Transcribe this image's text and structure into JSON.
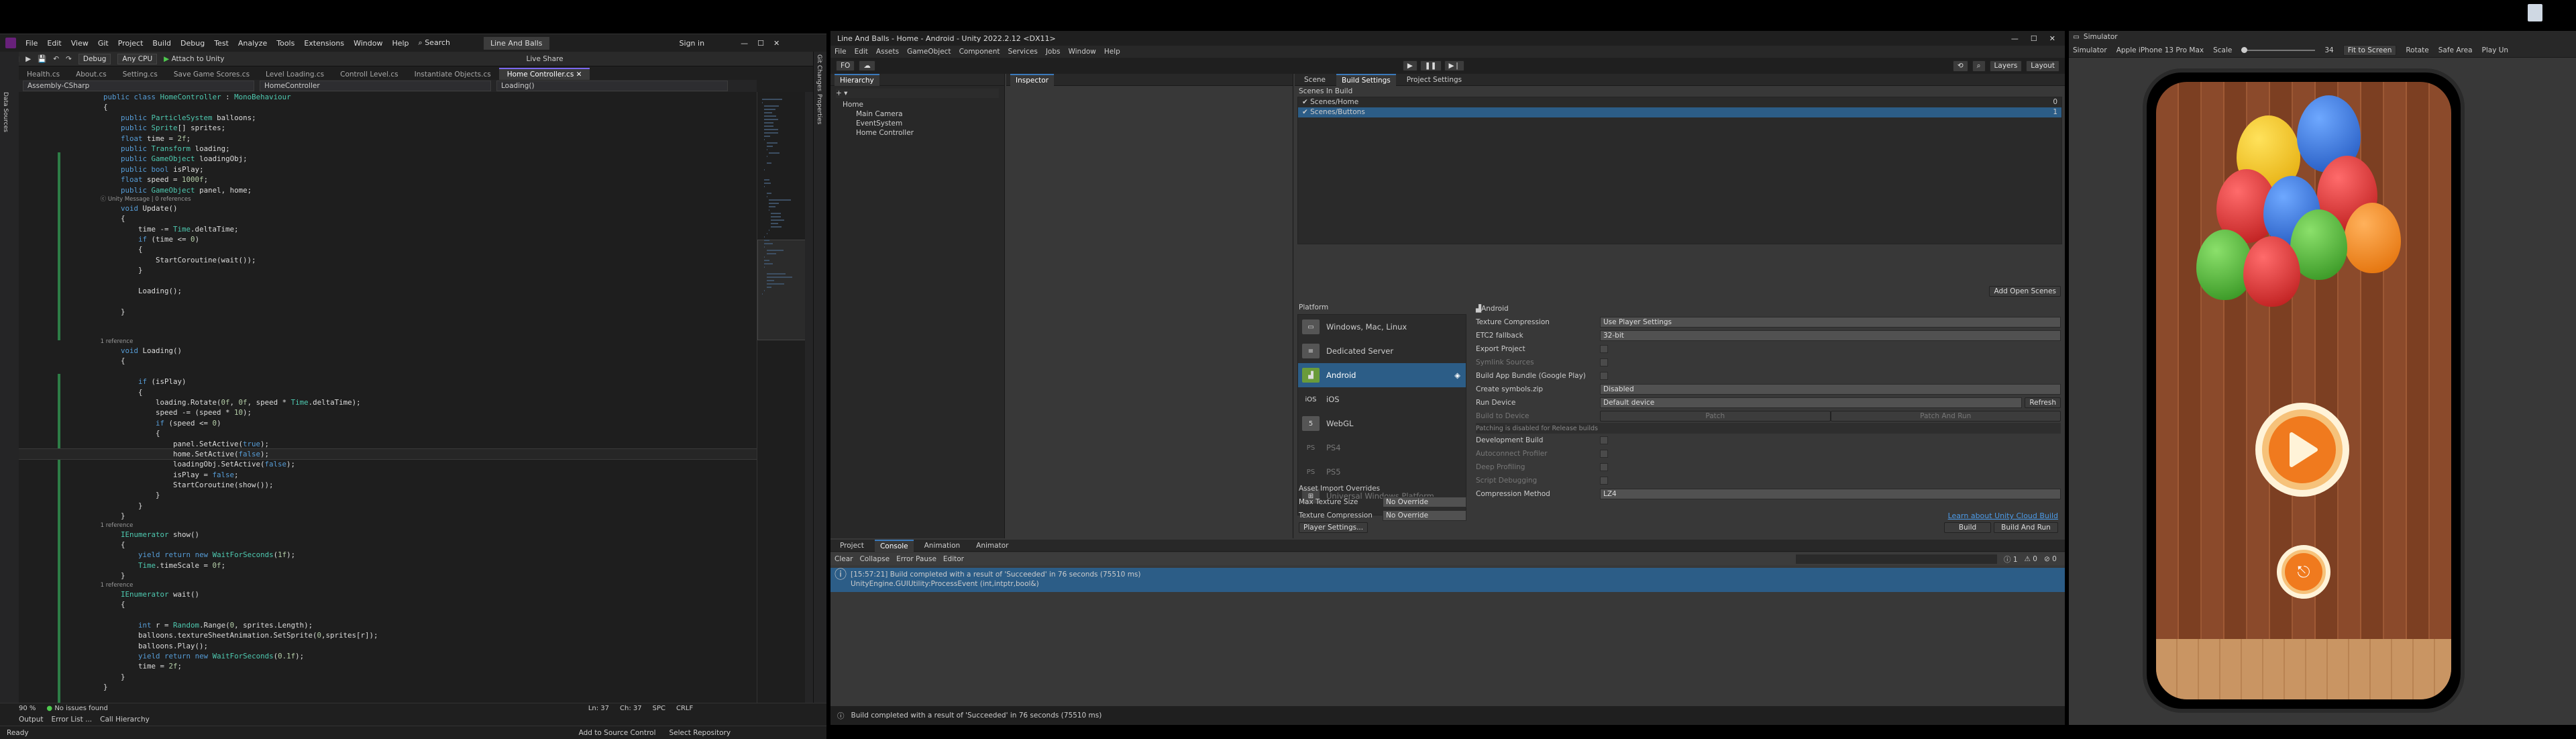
{
  "vs": {
    "menu": [
      "File",
      "Edit",
      "View",
      "Git",
      "Project",
      "Build",
      "Debug",
      "Test",
      "Analyze",
      "Tools",
      "Extensions",
      "Window",
      "Help"
    ],
    "search": "Search",
    "solution": "Line And Balls",
    "signin": "Sign in",
    "toolbar": {
      "config": "Debug",
      "platform": "Any CPU",
      "attach": "Attach to Unity",
      "liveshare": "Live Share"
    },
    "tabs": [
      "Health.cs",
      "About.cs",
      "Setting.cs",
      "Save Game Scores.cs",
      "Level Loading.cs",
      "Controll Level.cs",
      "Instantiate Objects.cs",
      "Home Controller.cs"
    ],
    "active_tab": "Home Controller.cs",
    "nav": {
      "project": "Assembly-CSharp",
      "class": "HomeController",
      "member": "Loading()"
    },
    "rail_right": [
      "Git Changes",
      "Properties"
    ],
    "rail_left": [
      "Data Sources"
    ],
    "code": [
      {
        "t": "    public class HomeController : MonoBehaviour"
      },
      {
        "t": "    {"
      },
      {
        "t": "        public ParticleSystem balloons;"
      },
      {
        "t": "        public Sprite[] sprites;"
      },
      {
        "t": "        float time = 2f;"
      },
      {
        "t": "        public Transform loading;"
      },
      {
        "t": "        public GameObject loadingObj;"
      },
      {
        "t": "        public bool isPlay;"
      },
      {
        "t": "        float speed = 1000f;"
      },
      {
        "t": "        public GameObject panel, home;"
      },
      {
        "t": "        ⓒ Unity Message | 0 references",
        "cl": true
      },
      {
        "t": "        void Update()"
      },
      {
        "t": "        {"
      },
      {
        "t": "            time -= Time.deltaTime;"
      },
      {
        "t": "            if (time <= 0)"
      },
      {
        "t": "            {"
      },
      {
        "t": "                StartCoroutine(wait());"
      },
      {
        "t": "            }"
      },
      {
        "t": ""
      },
      {
        "t": "            Loading();"
      },
      {
        "t": ""
      },
      {
        "t": "        }"
      },
      {
        "t": ""
      },
      {
        "t": ""
      },
      {
        "t": "        1 reference",
        "cl": true
      },
      {
        "t": "        void Loading()"
      },
      {
        "t": "        {"
      },
      {
        "t": ""
      },
      {
        "t": "            if (isPlay)"
      },
      {
        "t": "            {"
      },
      {
        "t": "                loading.Rotate(0f, 0f, speed * Time.deltaTime);"
      },
      {
        "t": "                speed -= (speed * 10);"
      },
      {
        "t": "                if (speed <= 0)"
      },
      {
        "t": "                {"
      },
      {
        "t": "                    panel.SetActive(true);"
      },
      {
        "t": "                    home.SetActive(false);",
        "hl": true
      },
      {
        "t": "                    loadingObj.SetActive(false);"
      },
      {
        "t": "                    isPlay = false;"
      },
      {
        "t": "                    StartCoroutine(show());"
      },
      {
        "t": "                }"
      },
      {
        "t": "            }"
      },
      {
        "t": "        }"
      },
      {
        "t": "        1 reference",
        "cl": true
      },
      {
        "t": "        IEnumerator show()"
      },
      {
        "t": "        {"
      },
      {
        "t": "            yield return new WaitForSeconds(1f);"
      },
      {
        "t": "            Time.timeScale = 0f;"
      },
      {
        "t": "        }"
      },
      {
        "t": "        1 reference",
        "cl": true
      },
      {
        "t": "        IEnumerator wait()"
      },
      {
        "t": "        {"
      },
      {
        "t": ""
      },
      {
        "t": "            int r = Random.Range(0, sprites.Length);"
      },
      {
        "t": "            balloons.textureSheetAnimation.SetSprite(0,sprites[r]);"
      },
      {
        "t": "            balloons.Play();"
      },
      {
        "t": "            yield return new WaitForSeconds(0.1f);"
      },
      {
        "t": "            time = 2f;"
      },
      {
        "t": "        }"
      },
      {
        "t": "    }"
      }
    ],
    "statusline": {
      "zoom": "90 %",
      "issues": "No issues found",
      "ln": "Ln: 37",
      "ch": "Ch: 37",
      "spc": "SPC",
      "crlf": "CRLF"
    },
    "bottom_tabs": [
      "Output",
      "Error List ...",
      "Call Hierarchy"
    ],
    "status": {
      "ready": "Ready",
      "source_control": "Add to Source Control",
      "repo": "Select Repository"
    }
  },
  "unity": {
    "title": "Line And Balls - Home - Android - Unity 2022.2.12 <DX11>",
    "menu": [
      "File",
      "Edit",
      "Assets",
      "GameObject",
      "Component",
      "Services",
      "Jobs",
      "Window",
      "Help"
    ],
    "toolbar": {
      "account": "FO",
      "layers": "Layers",
      "layout": "Layout"
    },
    "hierarchy_tab": "Hierarchy",
    "hierarchy": [
      "Home",
      "Main Camera",
      "EventSystem",
      "Home Controller"
    ],
    "inspector_tab": "Inspector",
    "build_tabs": [
      "Scene",
      "Build Settings",
      "Project Settings"
    ],
    "scenes_title": "Scenes In Build",
    "scenes": [
      {
        "name": "Scenes/Home",
        "idx": "0"
      },
      {
        "name": "Scenes/Buttons",
        "idx": "1"
      }
    ],
    "add_open_scenes": "Add Open Scenes",
    "platform_title": "Platform",
    "platforms": [
      {
        "name": "Windows, Mac, Linux",
        "icon": "monitor-icon"
      },
      {
        "name": "Dedicated Server",
        "icon": "server-icon"
      },
      {
        "name": "Android",
        "icon": "android-icon"
      },
      {
        "name": "iOS",
        "icon": "ios-icon"
      },
      {
        "name": "WebGL",
        "icon": "webgl-icon"
      },
      {
        "name": "PS4",
        "icon": "ps4-icon"
      },
      {
        "name": "PS5",
        "icon": "ps5-icon"
      },
      {
        "name": "Universal Windows Platform",
        "icon": "windows-icon"
      }
    ],
    "selected_platform": "Android",
    "android_title": "Android",
    "settings": [
      {
        "label": "Texture Compression",
        "value": "Use Player Settings"
      },
      {
        "label": "ETC2 fallback",
        "value": "32-bit"
      },
      {
        "label": "Export Project",
        "value": ""
      },
      {
        "label": "Symlink Sources",
        "value": ""
      },
      {
        "label": "Build App Bundle (Google Play)",
        "value": ""
      },
      {
        "label": "Create symbols.zip",
        "value": "Disabled"
      },
      {
        "label": "Run Device",
        "value": "Default device"
      },
      {
        "label": "Build to Device",
        "value": ""
      },
      {
        "label": "Patching is disabled for Release builds",
        "value": ""
      },
      {
        "label": "Development Build",
        "value": ""
      },
      {
        "label": "Autoconnect Profiler",
        "value": ""
      },
      {
        "label": "Deep Profiling",
        "value": ""
      },
      {
        "label": "Script Debugging",
        "value": ""
      },
      {
        "label": "Compression Method",
        "value": "LZ4"
      }
    ],
    "refresh": "Refresh",
    "patch": "Patch",
    "patch_run": "Patch And Run",
    "asset_overrides": "Asset Import Overrides",
    "max_texture": {
      "label": "Max Texture Size",
      "value": "No Override"
    },
    "tex_compression": {
      "label": "Texture Compression",
      "value": "No Override"
    },
    "player_settings": "Player Settings...",
    "cloud_build": "Learn about Unity Cloud Build",
    "build": "Build",
    "build_and_run": "Build And Run",
    "bottom_tabs": [
      "Project",
      "Console",
      "Animation",
      "Animator"
    ],
    "console_toolbar": [
      "Clear",
      "Collapse",
      "Error Pause",
      "Editor"
    ],
    "console_counts": {
      "log": "1",
      "warn": "0",
      "err": "0"
    },
    "console_message": "[15:57:21] Build completed with a result of 'Succeeded' in 76 seconds (75510 ms)",
    "console_message2": "UnityEngine.GUIUtility:ProcessEvent (int,intptr,bool&)",
    "status": "Build completed with a result of 'Succeeded' in 76 seconds (75510 ms)"
  },
  "sim": {
    "tab": "Simulator",
    "device": "Apple iPhone 13 Pro Max",
    "mode": "Simulator",
    "scale_label": "Scale",
    "scale_value": "34",
    "fit": "Fit to Screen",
    "rotate": "Rotate",
    "safe_area": "Safe Area",
    "play_mode": "Play Un",
    "colors": {
      "orange": "#f07a1e",
      "cream": "#fff3d8"
    }
  }
}
